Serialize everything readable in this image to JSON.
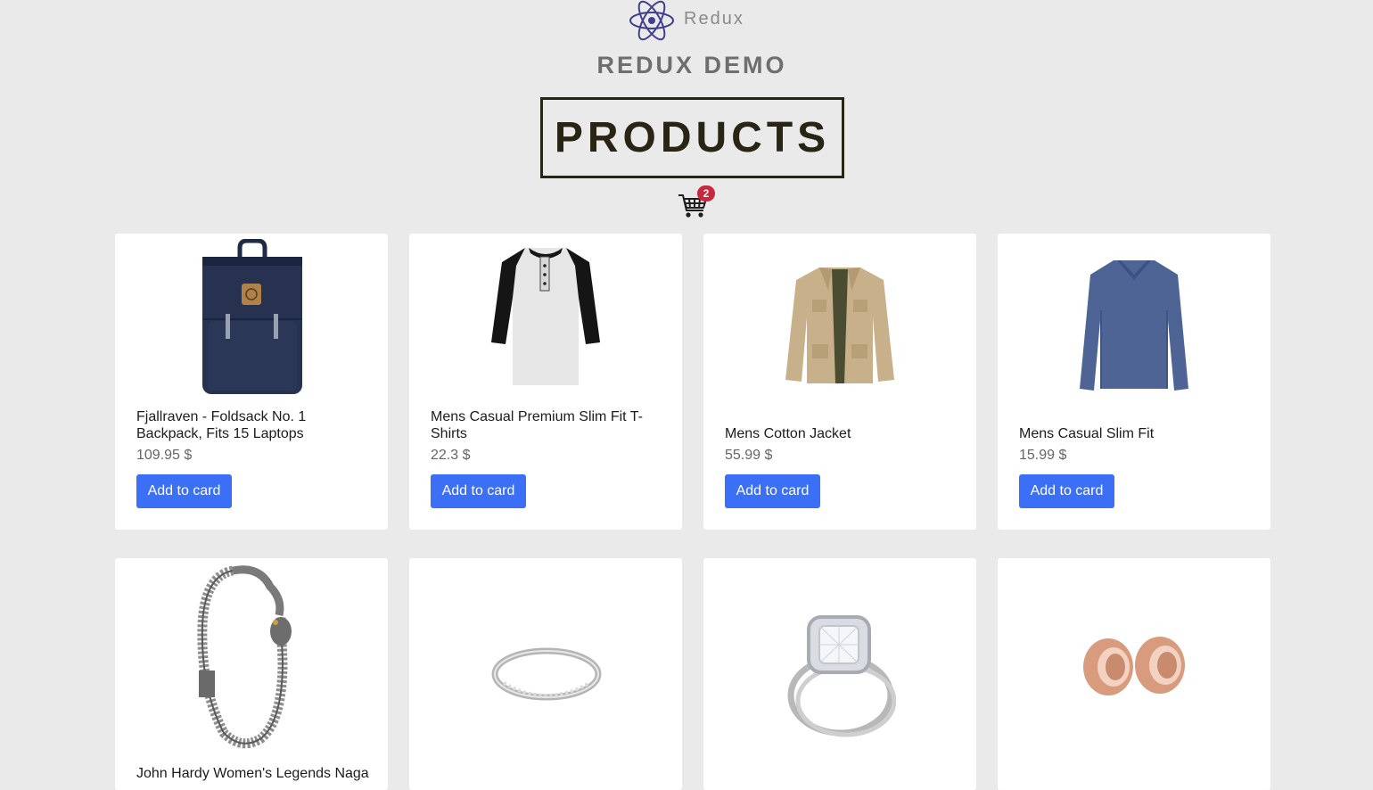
{
  "brand": {
    "logo_icon": "react-atom-icon",
    "name": "Redux"
  },
  "header": {
    "demo_title": "REDUX DEMO",
    "page_title": "PRODUCTS"
  },
  "cart": {
    "icon": "shopping-cart-icon",
    "count": "2",
    "badge_color": "#c8283c"
  },
  "colors": {
    "accent": "#3b6ff5",
    "background": "#eaeaea",
    "card": "#ffffff"
  },
  "products": [
    {
      "image": "backpack",
      "title": "Fjallraven - Foldsack No. 1 Backpack, Fits 15 Laptops",
      "price": "109.95 $",
      "button": "Add to card"
    },
    {
      "image": "henley-shirt",
      "title": "Mens Casual Premium Slim Fit T-Shirts",
      "price": "22.3 $",
      "button": "Add to card"
    },
    {
      "image": "cotton-jacket",
      "title": "Mens Cotton Jacket",
      "price": "55.99 $",
      "button": "Add to card"
    },
    {
      "image": "long-sleeve-shirt",
      "title": "Mens Casual Slim Fit",
      "price": "15.99 $",
      "button": "Add to card"
    },
    {
      "image": "dragon-bracelet",
      "title": "John Hardy Women's Legends Naga"
    },
    {
      "image": "silver-ring"
    },
    {
      "image": "diamond-ring"
    },
    {
      "image": "rose-gold-plugs"
    }
  ]
}
